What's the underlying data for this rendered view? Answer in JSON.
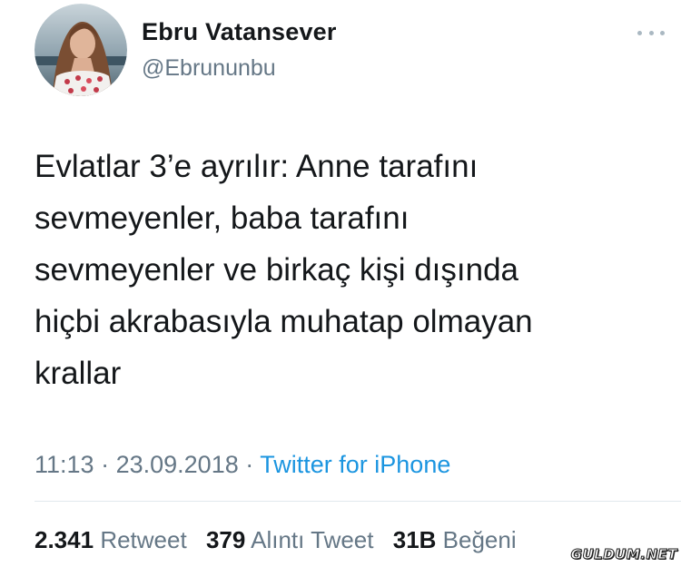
{
  "user": {
    "display_name": "Ebru Vatansever",
    "handle": "@Ebrununbu"
  },
  "tweet": {
    "text": "Evlatlar 3’e ayrılır: Anne tarafını\nsevmeyenler, baba tarafını\nsevmeyenler ve birkaç kişi dışında\nhiçbi akrabasıyla muhatap olmayan\nkrallar",
    "time": "11:13",
    "separator": "·",
    "date": "23.09.2018",
    "source": "Twitter for iPhone"
  },
  "stats": {
    "retweets": {
      "count": "2.341",
      "label": "Retweet"
    },
    "quotes": {
      "count": "379",
      "label": "Alıntı Tweet"
    },
    "likes": {
      "count": "31B",
      "label": "Beğeni"
    }
  },
  "watermark": "GULDUM.NET",
  "colors": {
    "text": "#14171a",
    "secondary": "#657786",
    "link": "#1b95e0",
    "divider": "#e1e8ed",
    "more_dots": "#aab8c2"
  },
  "icons": {
    "more": "more-horizontal-icon"
  }
}
